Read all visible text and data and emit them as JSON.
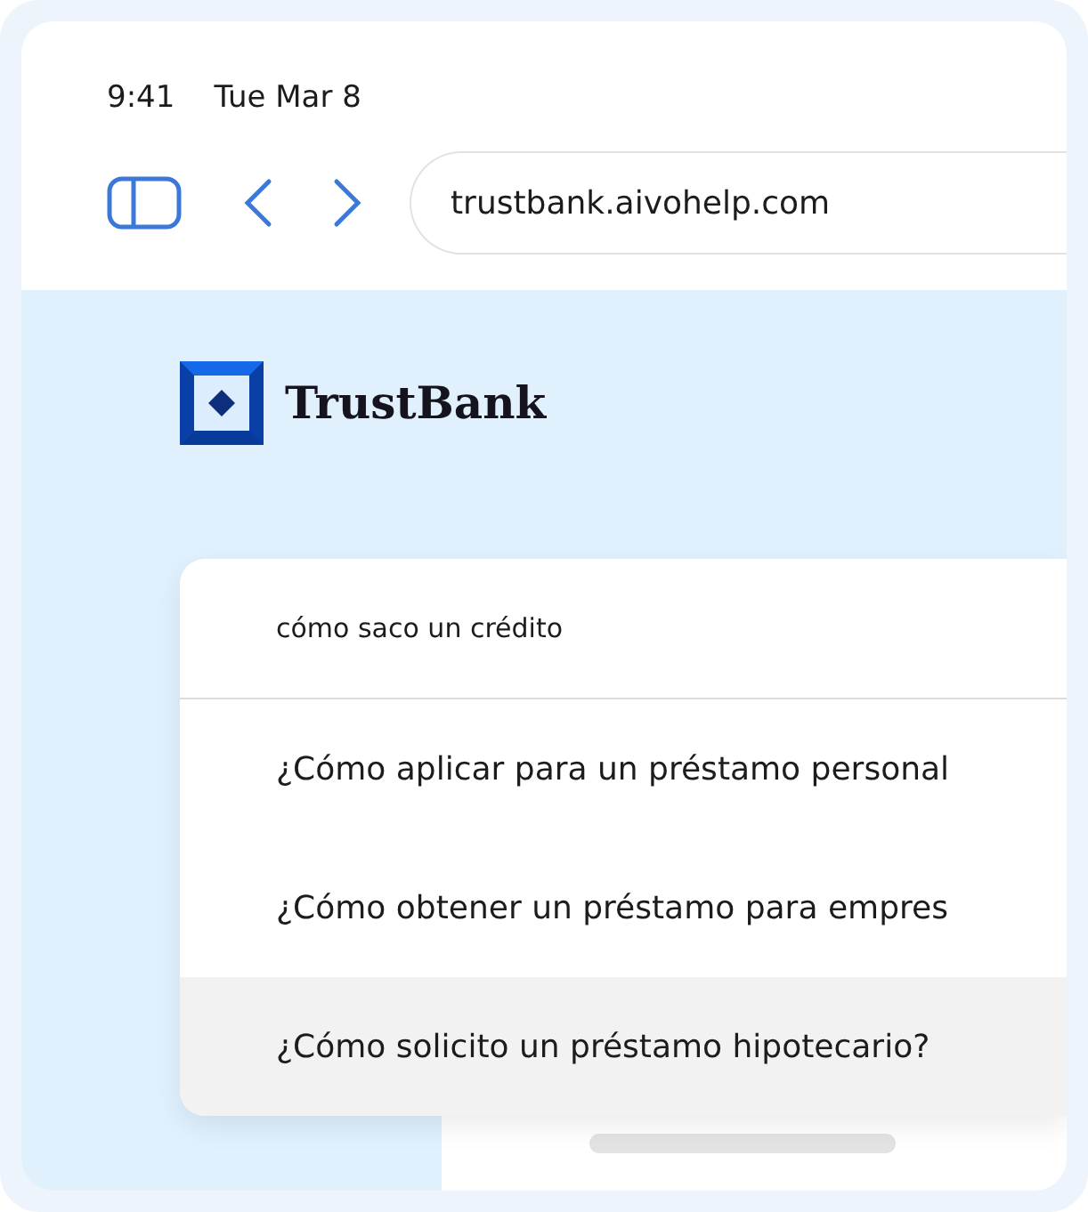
{
  "status_bar": {
    "time": "9:41",
    "date": "Tue Mar 8"
  },
  "browser": {
    "url": "trustbank.aivohelp.com"
  },
  "logo": {
    "name": "TrustBank"
  },
  "search": {
    "value": "cómo saco un crédito"
  },
  "suggestions": [
    {
      "text": "¿Cómo aplicar para un préstamo personal",
      "selected": false
    },
    {
      "text": "¿Cómo obtener un préstamo para empres",
      "selected": false
    },
    {
      "text": "¿Cómo solicito un préstamo hipotecario?",
      "selected": true
    }
  ]
}
